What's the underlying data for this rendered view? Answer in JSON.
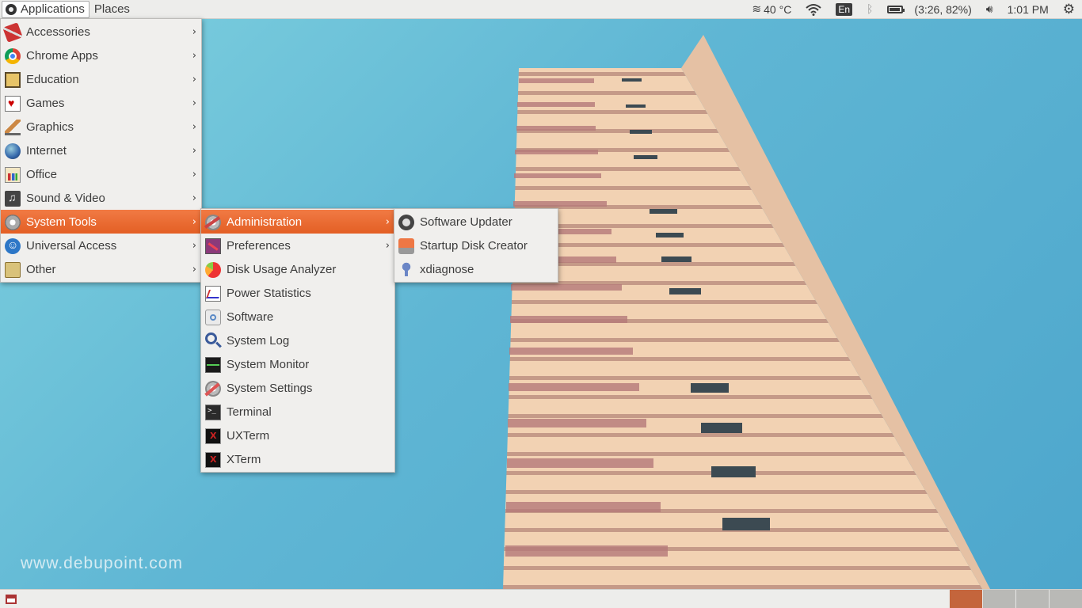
{
  "top_panel": {
    "applications_label": "Applications",
    "places_label": "Places",
    "weather": "40 °C",
    "keyboard_layout": "En",
    "battery": "(3:26, 82%)",
    "clock": "1:01 PM"
  },
  "applications_menu": [
    {
      "label": "Accessories",
      "icon": "accessories-icon"
    },
    {
      "label": "Chrome Apps",
      "icon": "chrome-icon"
    },
    {
      "label": "Education",
      "icon": "education-icon"
    },
    {
      "label": "Games",
      "icon": "games-icon"
    },
    {
      "label": "Graphics",
      "icon": "graphics-icon"
    },
    {
      "label": "Internet",
      "icon": "internet-icon"
    },
    {
      "label": "Office",
      "icon": "office-icon"
    },
    {
      "label": "Sound & Video",
      "icon": "sound-video-icon"
    },
    {
      "label": "System Tools",
      "icon": "system-tools-icon",
      "active": true
    },
    {
      "label": "Universal Access",
      "icon": "universal-access-icon"
    },
    {
      "label": "Other",
      "icon": "other-icon"
    }
  ],
  "system_tools_menu": [
    {
      "label": "Administration",
      "icon": "administration-icon",
      "active": true
    },
    {
      "label": "Preferences",
      "icon": "preferences-icon"
    },
    {
      "label": "Disk Usage Analyzer",
      "icon": "disk-usage-icon"
    },
    {
      "label": "Power Statistics",
      "icon": "power-statistics-icon"
    },
    {
      "label": "Software",
      "icon": "software-icon"
    },
    {
      "label": "System Log",
      "icon": "system-log-icon"
    },
    {
      "label": "System Monitor",
      "icon": "system-monitor-icon"
    },
    {
      "label": "System Settings",
      "icon": "system-settings-icon"
    },
    {
      "label": "Terminal",
      "icon": "terminal-icon"
    },
    {
      "label": "UXTerm",
      "icon": "uxterm-icon"
    },
    {
      "label": "XTerm",
      "icon": "xterm-icon"
    }
  ],
  "administration_menu": [
    {
      "label": "Software Updater",
      "icon": "software-updater-icon"
    },
    {
      "label": "Startup Disk Creator",
      "icon": "startup-disk-creator-icon"
    },
    {
      "label": "xdiagnose",
      "icon": "xdiagnose-icon"
    }
  ],
  "watermark": "www.debupoint.com",
  "colors": {
    "menu_highlight": "#e8672f",
    "panel_bg": "#ededeb",
    "sky": "#5fb6d4",
    "active_workspace": "#c4653c"
  }
}
